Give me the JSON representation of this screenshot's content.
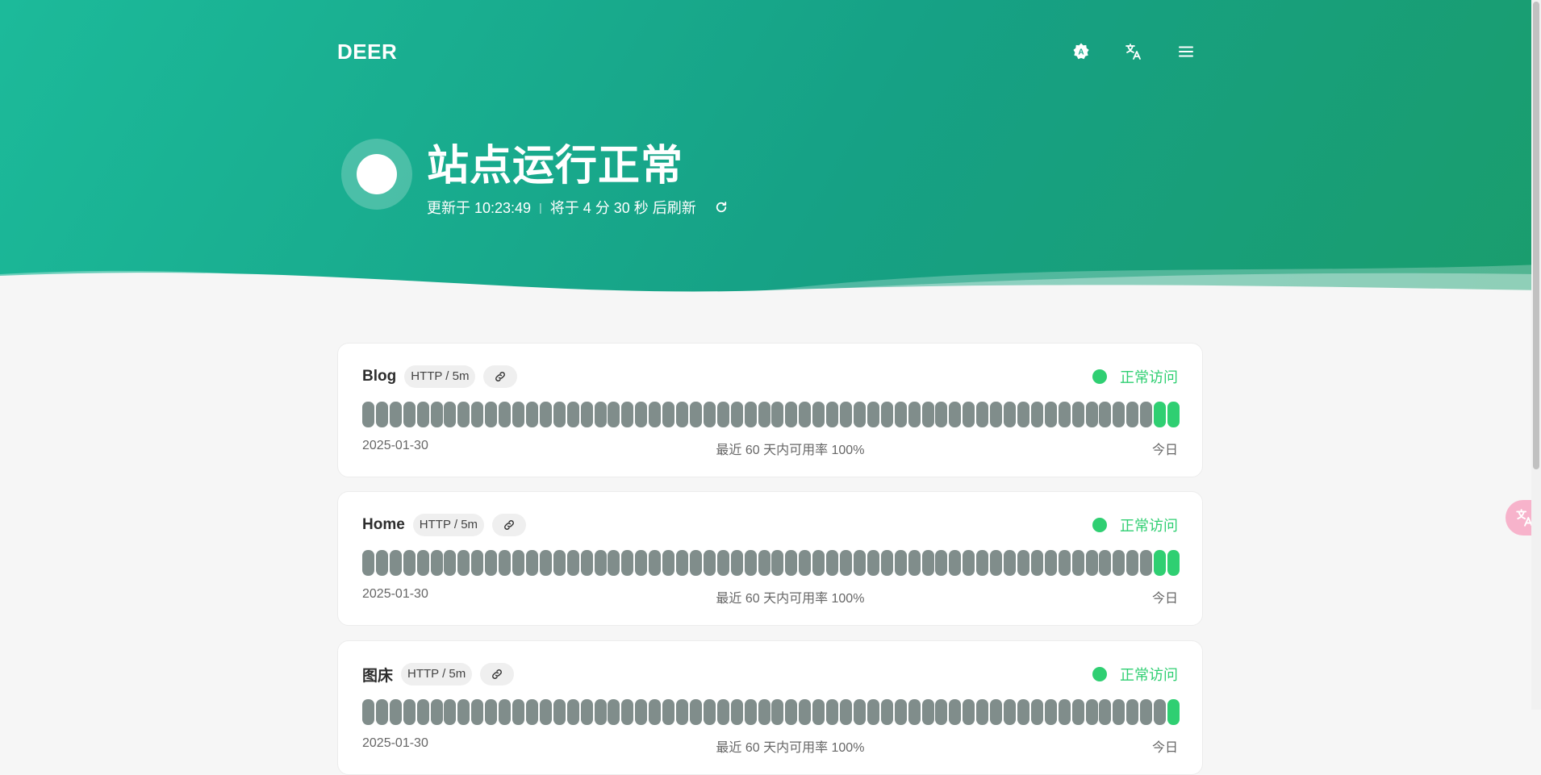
{
  "header": {
    "logo": "DEER",
    "actions": [
      {
        "icon": "theme-auto-icon"
      },
      {
        "icon": "translate-icon"
      },
      {
        "icon": "menu-icon"
      }
    ]
  },
  "status": {
    "title": "站点运行正常",
    "updated": "更新于 10:23:49",
    "separator": "|",
    "next_refresh": "将于 4 分 30 秒 后刷新",
    "refresh_icon": "refresh-icon"
  },
  "colors": {
    "accent": "#1cba9a",
    "up": "#2fcf72",
    "down": "#808d8b"
  },
  "monitors": [
    {
      "name": "Blog",
      "type": "HTTP / 5m",
      "status": "正常访问",
      "start_date": "2025-01-30",
      "uptime_text": "最近 60 天内可用率 100%",
      "end_label": "今日",
      "bars_total": 60,
      "bars_up": 2
    },
    {
      "name": "Home",
      "type": "HTTP / 5m",
      "status": "正常访问",
      "start_date": "2025-01-30",
      "uptime_text": "最近 60 天内可用率 100%",
      "end_label": "今日",
      "bars_total": 60,
      "bars_up": 2
    },
    {
      "name": "图床",
      "type": "HTTP / 5m",
      "status": "正常访问",
      "start_date": "2025-01-30",
      "uptime_text": "最近 60 天内可用率 100%",
      "end_label": "今日",
      "bars_total": 60,
      "bars_up": 1
    }
  ]
}
